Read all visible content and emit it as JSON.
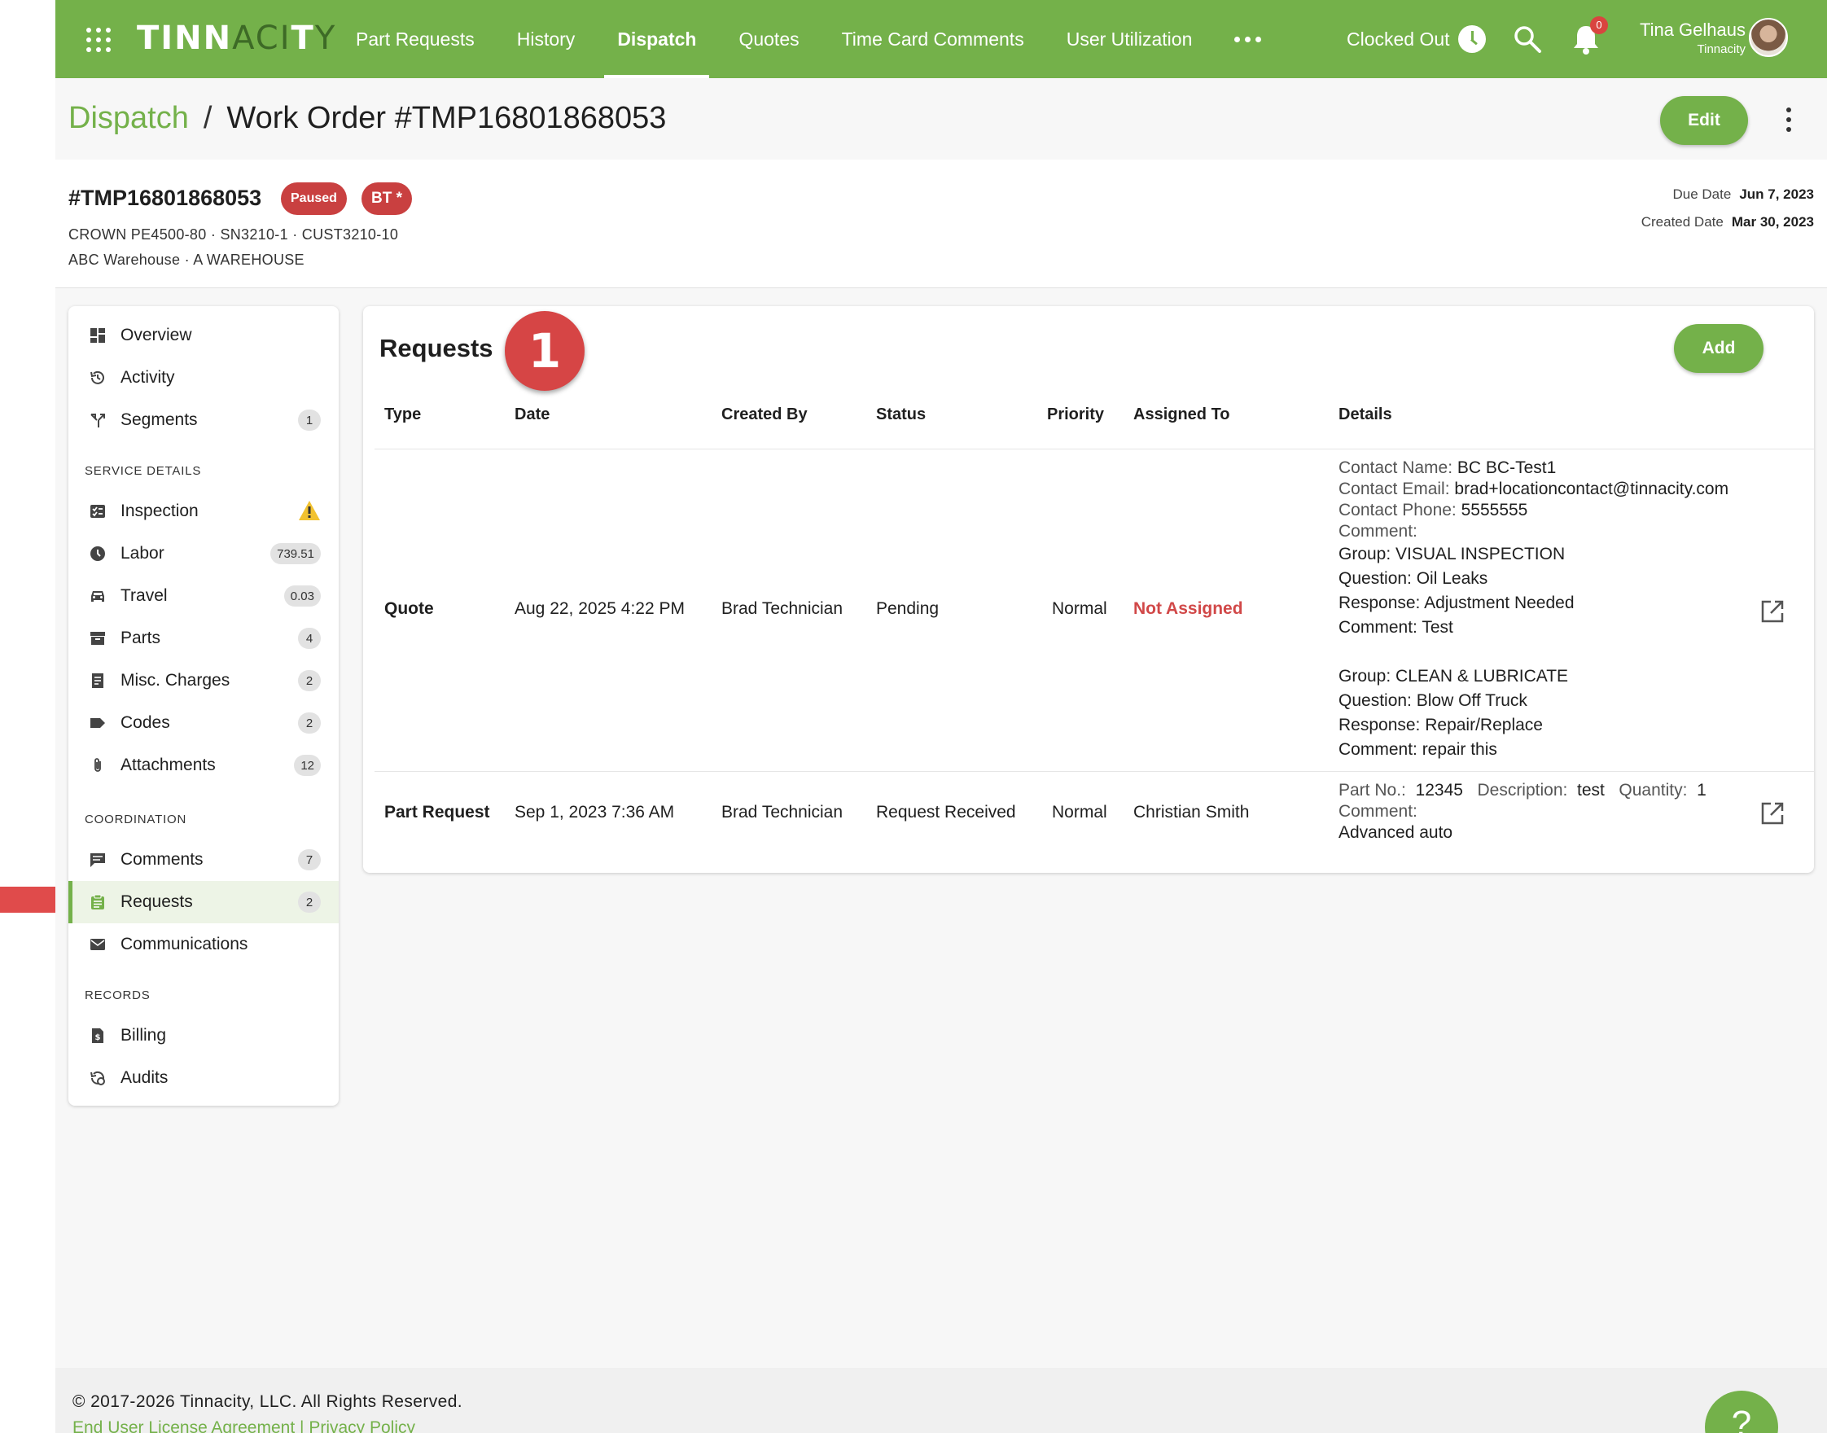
{
  "topbar": {
    "logo_bold": "TINN",
    "logo_thin": "ACI",
    "logo_bold2": "T",
    "logo_thin2": "Y",
    "nav": [
      "Part Requests",
      "History",
      "Dispatch",
      "Quotes",
      "Time Card Comments",
      "User Utilization"
    ],
    "active_nav": "Dispatch",
    "clock_status": "Clocked Out",
    "notifications_count": "0",
    "user_name": "Tina Gelhaus",
    "user_org": "Tinnacity",
    "brand_color": "#74b14a"
  },
  "header": {
    "breadcrumb_root": "Dispatch",
    "breadcrumb_sep": "/",
    "breadcrumb_current": "Work Order #TMP16801868053",
    "edit_label": "Edit"
  },
  "work_order": {
    "id": "#TMP16801868053",
    "status_badge": "Paused",
    "tech_badge": "BT *",
    "equipment_line": "CROWN PE4500-80 · SN3210-1 · CUST3210-10",
    "location_line": "ABC Warehouse · A WAREHOUSE",
    "due_label": "Due Date",
    "due_value": "Jun 7, 2023",
    "created_label": "Created Date",
    "created_value": "Mar 30, 2023"
  },
  "sidebar": {
    "items": [
      {
        "label": "Overview",
        "icon": "dashboard-icon"
      },
      {
        "label": "Activity",
        "icon": "history-icon"
      },
      {
        "label": "Segments",
        "icon": "split-icon",
        "count": "1"
      }
    ],
    "service_heading": "SERVICE DETAILS",
    "service_items": [
      {
        "label": "Inspection",
        "icon": "checklist-icon",
        "warning": true
      },
      {
        "label": "Labor",
        "icon": "clock-icon",
        "count": "739.51"
      },
      {
        "label": "Travel",
        "icon": "car-icon",
        "count": "0.03"
      },
      {
        "label": "Parts",
        "icon": "box-icon",
        "count": "4"
      },
      {
        "label": "Misc. Charges",
        "icon": "receipt-icon",
        "count": "2"
      },
      {
        "label": "Codes",
        "icon": "tag-icon",
        "count": "2"
      },
      {
        "label": "Attachments",
        "icon": "paperclip-icon",
        "count": "12"
      }
    ],
    "coordination_heading": "COORDINATION",
    "coordination_items": [
      {
        "label": "Comments",
        "icon": "comment-icon",
        "count": "7"
      },
      {
        "label": "Requests",
        "icon": "clipboard-icon",
        "count": "2",
        "active": true
      },
      {
        "label": "Communications",
        "icon": "mail-icon"
      }
    ],
    "records_heading": "RECORDS",
    "records_items": [
      {
        "label": "Billing",
        "icon": "invoice-icon"
      },
      {
        "label": "Audits",
        "icon": "audit-icon"
      }
    ]
  },
  "requests": {
    "title": "Requests",
    "step_marker": "1",
    "add_label": "Add",
    "columns": [
      "Type",
      "Date",
      "Created By",
      "Status",
      "Priority",
      "Assigned To",
      "Details"
    ],
    "rows": [
      {
        "type": "Quote",
        "date": "Aug 22, 2025 4:22 PM",
        "created_by": "Brad Technician",
        "status": "Pending",
        "priority": "Normal",
        "assigned_to": "Not Assigned",
        "contact_name_label": "Contact Name:",
        "contact_name": "BC BC-Test1",
        "contact_email_label": "Contact Email:",
        "contact_email": "brad+locationcontact@tinnacity.com",
        "contact_phone_label": "Contact Phone:",
        "contact_phone": "5555555",
        "comment_label": "Comment:",
        "groups": [
          {
            "group": "Group: VISUAL INSPECTION",
            "question": "Question: Oil Leaks",
            "response": "Response: Adjustment Needed",
            "comment": "Comment: Test"
          },
          {
            "group": "Group: CLEAN & LUBRICATE",
            "question": "Question: Blow Off Truck",
            "response": "Response: Repair/Replace",
            "comment": "Comment: repair this"
          }
        ]
      },
      {
        "type": "Part Request",
        "date": "Sep 1, 2023 7:36 AM",
        "created_by": "Brad Technician",
        "status": "Request Received",
        "priority": "Normal",
        "assigned_to": "Christian Smith",
        "part_no_label": "Part No.:",
        "part_no": "12345",
        "description_label": "Description:",
        "description": "test",
        "quantity_label": "Quantity:",
        "quantity": "1",
        "comment_label": "Comment:",
        "comment": "Advanced auto"
      }
    ]
  },
  "footer": {
    "copyright": "© 2017-2026 Tinnacity, LLC. All Rights Reserved.",
    "eula": "End User License Agreement",
    "separator": "|",
    "privacy": "Privacy Policy",
    "help_label": "?"
  }
}
